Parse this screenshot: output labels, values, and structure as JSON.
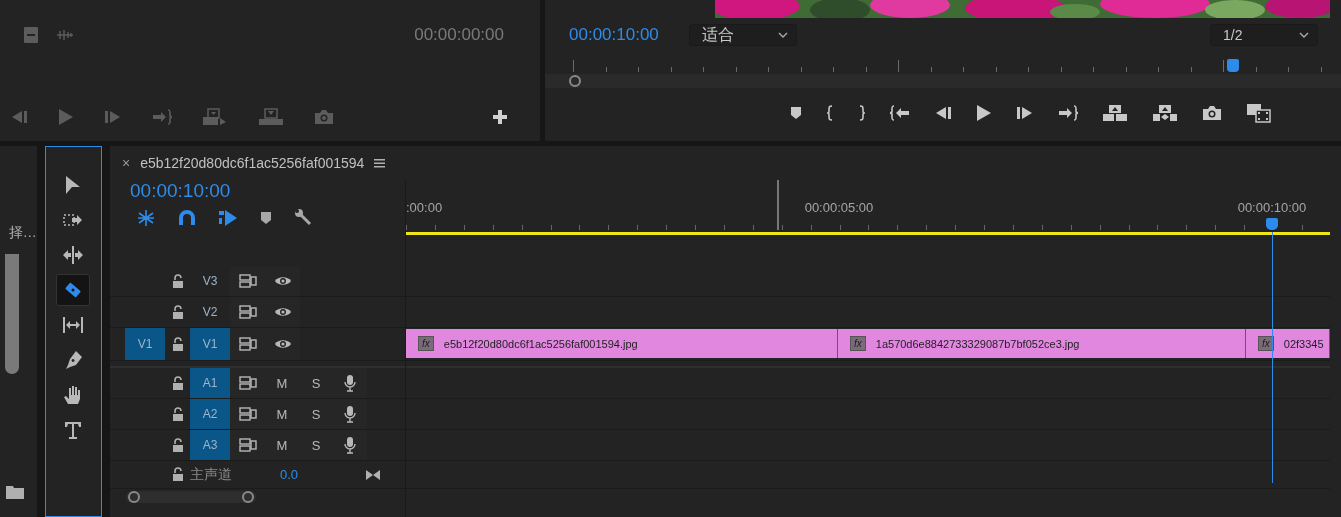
{
  "source_monitor": {
    "timecode": "00:00:00:00"
  },
  "program_monitor": {
    "timecode": "00:00:10:00",
    "zoom": "适合",
    "resolution": "1/2",
    "playhead": {
      "level": 0.86
    }
  },
  "project_panel": {
    "label": "择…"
  },
  "tools": [
    {
      "kind": "select",
      "selected": false
    },
    {
      "kind": "track-select",
      "selected": false
    },
    {
      "kind": "ripple",
      "selected": false
    },
    {
      "kind": "razor",
      "selected": true
    },
    {
      "kind": "slip",
      "selected": false
    },
    {
      "kind": "pen",
      "selected": false
    },
    {
      "kind": "hand",
      "selected": false
    },
    {
      "kind": "type",
      "selected": false
    }
  ],
  "timeline": {
    "tab_title": "e5b12f20d80dc6f1ac5256faf001594",
    "close": "×",
    "timecode": "00:00:10:00",
    "toggles": [
      {
        "kind": "nest",
        "on": true
      },
      {
        "kind": "snap",
        "on": true
      },
      {
        "kind": "linked",
        "on": true
      },
      {
        "kind": "marker",
        "on": false
      },
      {
        "kind": "settings",
        "on": false
      }
    ],
    "ruler": [
      ":00:00",
      "00:00:05:00",
      "00:00:10:00"
    ],
    "playhead": {
      "level": 0.937
    },
    "video_tracks": [
      {
        "label": "V3",
        "targeted": false
      },
      {
        "label": "V2",
        "targeted": false
      },
      {
        "label": "V1",
        "targeted": true,
        "source_patch": "V1",
        "clips": [
          {
            "effect": "fx",
            "name": "e5b12f20d80dc6f1ac5256faf001594.jpg"
          },
          {
            "effect": "fx",
            "name": "1a570d6e8842733329087b7bf052ce3.jpg"
          },
          {
            "effect": "fx",
            "name": "02f3345"
          }
        ]
      }
    ],
    "audio_tracks": [
      {
        "label": "A1",
        "targeted": true,
        "mute": "M",
        "solo": "S"
      },
      {
        "label": "A2",
        "targeted": true,
        "mute": "M",
        "solo": "S"
      },
      {
        "label": "A3",
        "targeted": true,
        "mute": "M",
        "solo": "S"
      }
    ],
    "master": {
      "label": "主声道",
      "value": "0.0"
    }
  }
}
